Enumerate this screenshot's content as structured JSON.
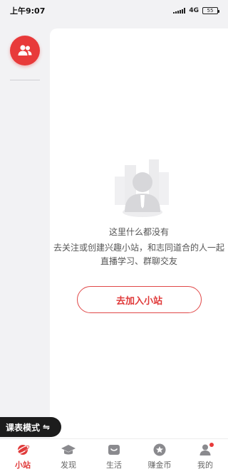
{
  "status_bar": {
    "time": "上午9:07",
    "network": "4G",
    "battery": "55"
  },
  "sidebar": {
    "group_icon": "group-icon"
  },
  "empty_state": {
    "title": "这里什么都没有",
    "description": "去关注或创建兴趣小站，和志同道合的人一起直播学习、群聊交友",
    "button": "去加入小站"
  },
  "mode_toggle": {
    "label": "课表模式",
    "icon": "swap-icon"
  },
  "bottom_nav": {
    "items": [
      {
        "label": "小站",
        "icon": "planet-icon",
        "active": true
      },
      {
        "label": "发现",
        "icon": "graduation-cap-icon",
        "active": false
      },
      {
        "label": "生活",
        "icon": "cup-icon",
        "active": false
      },
      {
        "label": "赚金币",
        "icon": "coin-icon",
        "active": false
      },
      {
        "label": "我的",
        "icon": "profile-icon",
        "active": false
      }
    ]
  },
  "colors": {
    "accent": "#e83a3a",
    "background": "#f2f2f4",
    "card": "#ffffff"
  }
}
